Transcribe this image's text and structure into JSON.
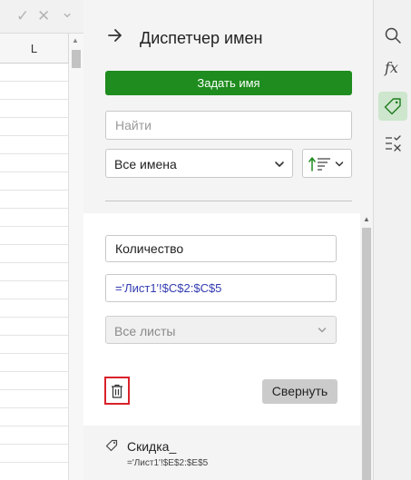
{
  "formula_bar": {
    "confirm_glyph": "✓",
    "cancel_glyph": "✕",
    "expand_glyph": "⌄"
  },
  "sheet": {
    "column_header": "L"
  },
  "panel": {
    "title": "Диспетчер имен",
    "define_name_label": "Задать имя",
    "search_placeholder": "Найти",
    "filter_value": "Все имена",
    "expanded_name": {
      "name": "Количество",
      "reference": "='Лист1'!$C$2:$C$5",
      "scope_value": "Все листы",
      "collapse_label": "Свернуть"
    },
    "names_list": [
      {
        "title": "Скидка_",
        "reference": "='Лист1'!$E$2:$E$5"
      }
    ]
  },
  "colors": {
    "primary_green": "#1e8c1e",
    "reference_blue": "#333cb0",
    "delete_highlight": "#d9222a",
    "active_rail": "#cde6cd"
  },
  "icons": {
    "rail": [
      "search-icon",
      "function-icon",
      "tag-icon",
      "check-list-icon"
    ],
    "header": "arrow-right-icon"
  }
}
